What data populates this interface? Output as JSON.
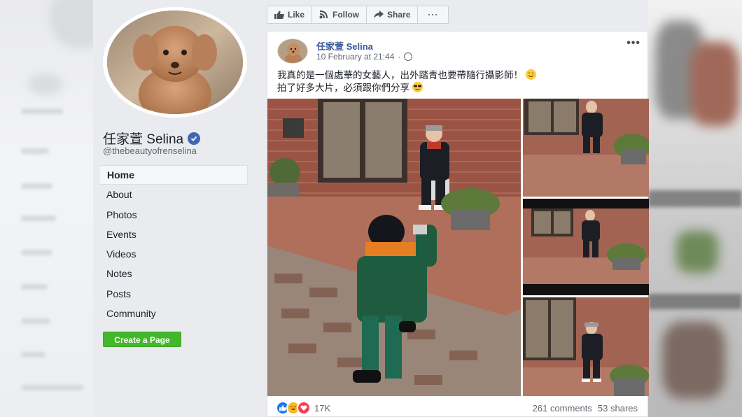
{
  "page": {
    "name": "任家萱 Selina",
    "handle": "@thebeautyofrenselina",
    "create_page_label": "Create a Page"
  },
  "nav": {
    "items": [
      "Home",
      "About",
      "Photos",
      "Events",
      "Videos",
      "Notes",
      "Posts",
      "Community"
    ],
    "active": "Home"
  },
  "actions": {
    "like": "Like",
    "follow": "Follow",
    "share": "Share",
    "more": "···"
  },
  "post": {
    "author": "任家萱 Selina",
    "date": "10 February at 21:44",
    "privacy_icon": "globe-icon",
    "text_line1": "我真的是一個處華的女藝人，出外踏青也要帶隨行攝影師！",
    "text_line2": "拍了好多大片，必須跟你們分享",
    "reactions_count": "17K",
    "comments": "261 comments",
    "shares": "53 shares",
    "reaction_types": [
      "like-icon",
      "haha-icon",
      "love-icon"
    ]
  },
  "colors": {
    "page_bg": "#e9ebee",
    "link_blue": "#385898",
    "verified_blue": "#4267b2",
    "create_green": "#42b72a"
  }
}
